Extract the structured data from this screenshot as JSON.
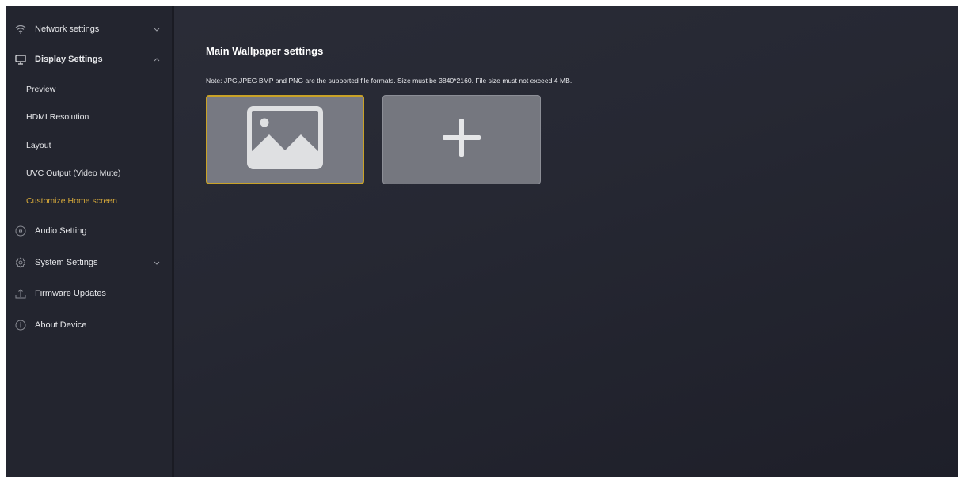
{
  "sidebar": {
    "items": [
      {
        "label": "Network settings",
        "icon": "wifi-icon",
        "chevron": "chevron-down-icon"
      },
      {
        "label": "Display Settings",
        "icon": "monitor-icon",
        "chevron": "chevron-up-icon"
      },
      {
        "label": "Audio Setting",
        "icon": "audio-icon"
      },
      {
        "label": "System Settings",
        "icon": "gear-icon",
        "chevron": "chevron-down-icon"
      },
      {
        "label": "Firmware Updates",
        "icon": "upload-icon"
      },
      {
        "label": "About Device",
        "icon": "info-icon"
      }
    ],
    "display_subitems": [
      {
        "label": "Preview"
      },
      {
        "label": "HDMI Resolution"
      },
      {
        "label": "Layout"
      },
      {
        "label": "UVC Output (Video Mute)"
      },
      {
        "label": "Customize Home screen",
        "active": true
      }
    ]
  },
  "main": {
    "title": "Main Wallpaper settings",
    "note": "Note: JPG,JPEG BMP and PNG are the supported file formats. Size must be 3840*2160. File size must not exceed 4 MB.",
    "tiles": [
      {
        "icon": "image-icon",
        "selected": true
      },
      {
        "icon": "plus-icon"
      }
    ]
  },
  "colors": {
    "accent": "#d6a93a",
    "background": "#262833",
    "sidebar": "#23252f",
    "tile": "#777982"
  }
}
